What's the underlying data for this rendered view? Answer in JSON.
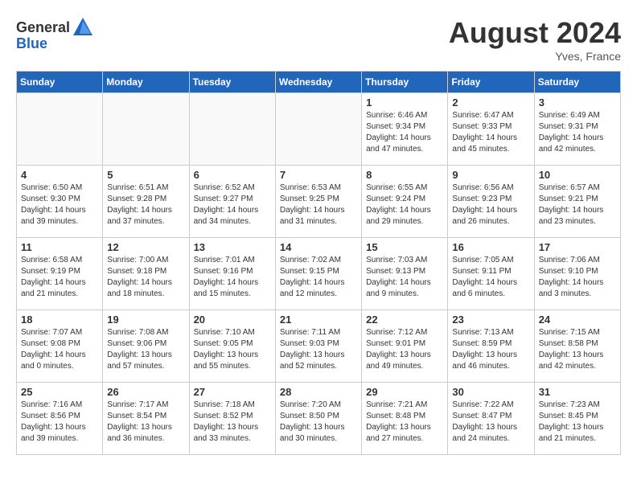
{
  "header": {
    "logo_general": "General",
    "logo_blue": "Blue",
    "month_year": "August 2024",
    "location": "Yves, France"
  },
  "days_of_week": [
    "Sunday",
    "Monday",
    "Tuesday",
    "Wednesday",
    "Thursday",
    "Friday",
    "Saturday"
  ],
  "weeks": [
    [
      {
        "day": "",
        "info": ""
      },
      {
        "day": "",
        "info": ""
      },
      {
        "day": "",
        "info": ""
      },
      {
        "day": "",
        "info": ""
      },
      {
        "day": "1",
        "info": "Sunrise: 6:46 AM\nSunset: 9:34 PM\nDaylight: 14 hours\nand 47 minutes."
      },
      {
        "day": "2",
        "info": "Sunrise: 6:47 AM\nSunset: 9:33 PM\nDaylight: 14 hours\nand 45 minutes."
      },
      {
        "day": "3",
        "info": "Sunrise: 6:49 AM\nSunset: 9:31 PM\nDaylight: 14 hours\nand 42 minutes."
      }
    ],
    [
      {
        "day": "4",
        "info": "Sunrise: 6:50 AM\nSunset: 9:30 PM\nDaylight: 14 hours\nand 39 minutes."
      },
      {
        "day": "5",
        "info": "Sunrise: 6:51 AM\nSunset: 9:28 PM\nDaylight: 14 hours\nand 37 minutes."
      },
      {
        "day": "6",
        "info": "Sunrise: 6:52 AM\nSunset: 9:27 PM\nDaylight: 14 hours\nand 34 minutes."
      },
      {
        "day": "7",
        "info": "Sunrise: 6:53 AM\nSunset: 9:25 PM\nDaylight: 14 hours\nand 31 minutes."
      },
      {
        "day": "8",
        "info": "Sunrise: 6:55 AM\nSunset: 9:24 PM\nDaylight: 14 hours\nand 29 minutes."
      },
      {
        "day": "9",
        "info": "Sunrise: 6:56 AM\nSunset: 9:23 PM\nDaylight: 14 hours\nand 26 minutes."
      },
      {
        "day": "10",
        "info": "Sunrise: 6:57 AM\nSunset: 9:21 PM\nDaylight: 14 hours\nand 23 minutes."
      }
    ],
    [
      {
        "day": "11",
        "info": "Sunrise: 6:58 AM\nSunset: 9:19 PM\nDaylight: 14 hours\nand 21 minutes."
      },
      {
        "day": "12",
        "info": "Sunrise: 7:00 AM\nSunset: 9:18 PM\nDaylight: 14 hours\nand 18 minutes."
      },
      {
        "day": "13",
        "info": "Sunrise: 7:01 AM\nSunset: 9:16 PM\nDaylight: 14 hours\nand 15 minutes."
      },
      {
        "day": "14",
        "info": "Sunrise: 7:02 AM\nSunset: 9:15 PM\nDaylight: 14 hours\nand 12 minutes."
      },
      {
        "day": "15",
        "info": "Sunrise: 7:03 AM\nSunset: 9:13 PM\nDaylight: 14 hours\nand 9 minutes."
      },
      {
        "day": "16",
        "info": "Sunrise: 7:05 AM\nSunset: 9:11 PM\nDaylight: 14 hours\nand 6 minutes."
      },
      {
        "day": "17",
        "info": "Sunrise: 7:06 AM\nSunset: 9:10 PM\nDaylight: 14 hours\nand 3 minutes."
      }
    ],
    [
      {
        "day": "18",
        "info": "Sunrise: 7:07 AM\nSunset: 9:08 PM\nDaylight: 14 hours\nand 0 minutes."
      },
      {
        "day": "19",
        "info": "Sunrise: 7:08 AM\nSunset: 9:06 PM\nDaylight: 13 hours\nand 57 minutes."
      },
      {
        "day": "20",
        "info": "Sunrise: 7:10 AM\nSunset: 9:05 PM\nDaylight: 13 hours\nand 55 minutes."
      },
      {
        "day": "21",
        "info": "Sunrise: 7:11 AM\nSunset: 9:03 PM\nDaylight: 13 hours\nand 52 minutes."
      },
      {
        "day": "22",
        "info": "Sunrise: 7:12 AM\nSunset: 9:01 PM\nDaylight: 13 hours\nand 49 minutes."
      },
      {
        "day": "23",
        "info": "Sunrise: 7:13 AM\nSunset: 8:59 PM\nDaylight: 13 hours\nand 46 minutes."
      },
      {
        "day": "24",
        "info": "Sunrise: 7:15 AM\nSunset: 8:58 PM\nDaylight: 13 hours\nand 42 minutes."
      }
    ],
    [
      {
        "day": "25",
        "info": "Sunrise: 7:16 AM\nSunset: 8:56 PM\nDaylight: 13 hours\nand 39 minutes."
      },
      {
        "day": "26",
        "info": "Sunrise: 7:17 AM\nSunset: 8:54 PM\nDaylight: 13 hours\nand 36 minutes."
      },
      {
        "day": "27",
        "info": "Sunrise: 7:18 AM\nSunset: 8:52 PM\nDaylight: 13 hours\nand 33 minutes."
      },
      {
        "day": "28",
        "info": "Sunrise: 7:20 AM\nSunset: 8:50 PM\nDaylight: 13 hours\nand 30 minutes."
      },
      {
        "day": "29",
        "info": "Sunrise: 7:21 AM\nSunset: 8:48 PM\nDaylight: 13 hours\nand 27 minutes."
      },
      {
        "day": "30",
        "info": "Sunrise: 7:22 AM\nSunset: 8:47 PM\nDaylight: 13 hours\nand 24 minutes."
      },
      {
        "day": "31",
        "info": "Sunrise: 7:23 AM\nSunset: 8:45 PM\nDaylight: 13 hours\nand 21 minutes."
      }
    ]
  ]
}
